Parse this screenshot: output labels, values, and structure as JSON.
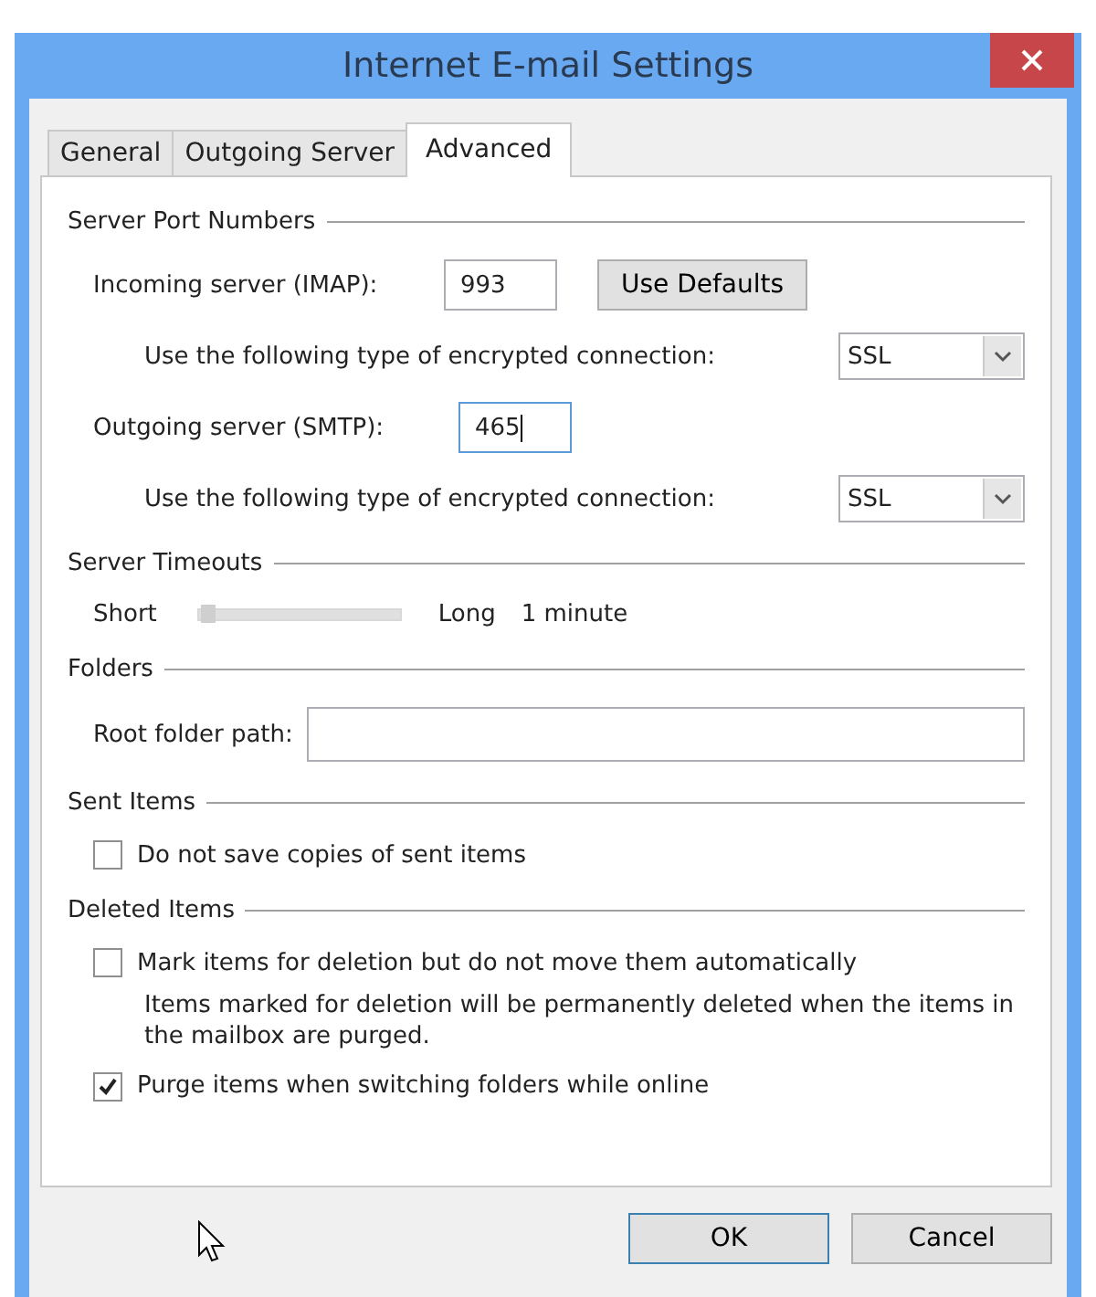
{
  "window": {
    "title": "Internet E-mail Settings"
  },
  "tabs": [
    {
      "label": "General",
      "selected": false
    },
    {
      "label": "Outgoing Server",
      "selected": false
    },
    {
      "label": "Advanced",
      "selected": true
    }
  ],
  "server_port_numbers": {
    "heading": "Server Port Numbers",
    "incoming": {
      "label": "Incoming server (IMAP):",
      "value": "993"
    },
    "use_defaults_button": "Use Defaults",
    "incoming_encryption": {
      "label": "Use the following type of encrypted connection:",
      "value": "SSL"
    },
    "outgoing": {
      "label": "Outgoing server (SMTP):",
      "value": "465",
      "focused": true
    },
    "outgoing_encryption": {
      "label": "Use the following type of encrypted connection:",
      "value": "SSL"
    }
  },
  "server_timeouts": {
    "heading": "Server Timeouts",
    "min_label": "Short",
    "max_label": "Long",
    "level": 0.05,
    "reading": "1 minute"
  },
  "folders": {
    "heading": "Folders",
    "root_folder_label": "Root folder path:"
  },
  "sent_items": {
    "heading": "Sent Items",
    "options": [
      {
        "label": "Do not save copies of sent items",
        "checked": false
      }
    ]
  },
  "deleted_items": {
    "heading": "Deleted Items",
    "options": [
      {
        "label": "Mark items for deletion but do not move them automatically",
        "checked": false,
        "note": "Items marked for deletion will be permanently deleted when the items in the mailbox are purged."
      },
      {
        "label": "Purge items when switching folders while online",
        "checked": true
      }
    ]
  },
  "buttons": [
    {
      "label": "OK",
      "default": true
    },
    {
      "label": "Cancel",
      "default": false
    }
  ]
}
